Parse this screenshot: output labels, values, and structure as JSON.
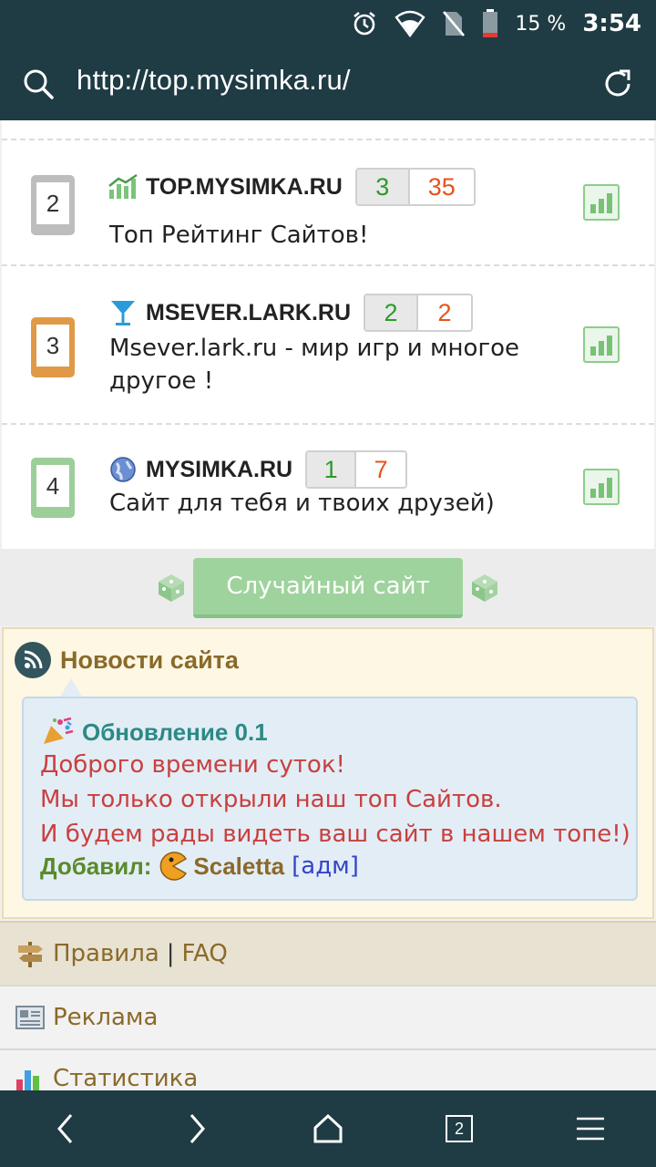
{
  "status_bar": {
    "battery_percent": "15 %",
    "time": "3:54"
  },
  "browser": {
    "url": "http://top.mysimka.ru/",
    "tabs_count": "2"
  },
  "sites": [
    {
      "rank": "2",
      "name": "TOP.MYSIMKA.RU",
      "in": "3",
      "out": "35",
      "description": "Топ Рейтинг Сайтов!",
      "icon": "chart-up-icon",
      "rank_color": "#bdbdbd"
    },
    {
      "rank": "3",
      "name": "MSEVER.LARK.RU",
      "in": "2",
      "out": "2",
      "description": "Msever.lark.ru - мир игр и многое другое !",
      "icon": "cocktail-icon",
      "rank_color": "#e09a47"
    },
    {
      "rank": "4",
      "name": "MYSIMKA.RU",
      "in": "1",
      "out": "7",
      "description": "Сайт для тебя и твоих друзей)",
      "icon": "globe-icon",
      "rank_color": "#9cce9a"
    }
  ],
  "random_button": "Случайный сайт",
  "news": {
    "header": "Новости сайта",
    "title": "Обновление 0.1",
    "lines": [
      "Доброго времени суток!",
      "Мы только открыли наш топ Сайтов.",
      "И будем рады видеть ваш сайт в нашем топе!)"
    ],
    "author_label": "Добавил:",
    "author": "Scaletta",
    "author_role": "[адм]"
  },
  "footer": {
    "rules": "Правила",
    "separator": "|",
    "faq": "FAQ",
    "ads": "Реклама",
    "stats": "Статистика"
  }
}
